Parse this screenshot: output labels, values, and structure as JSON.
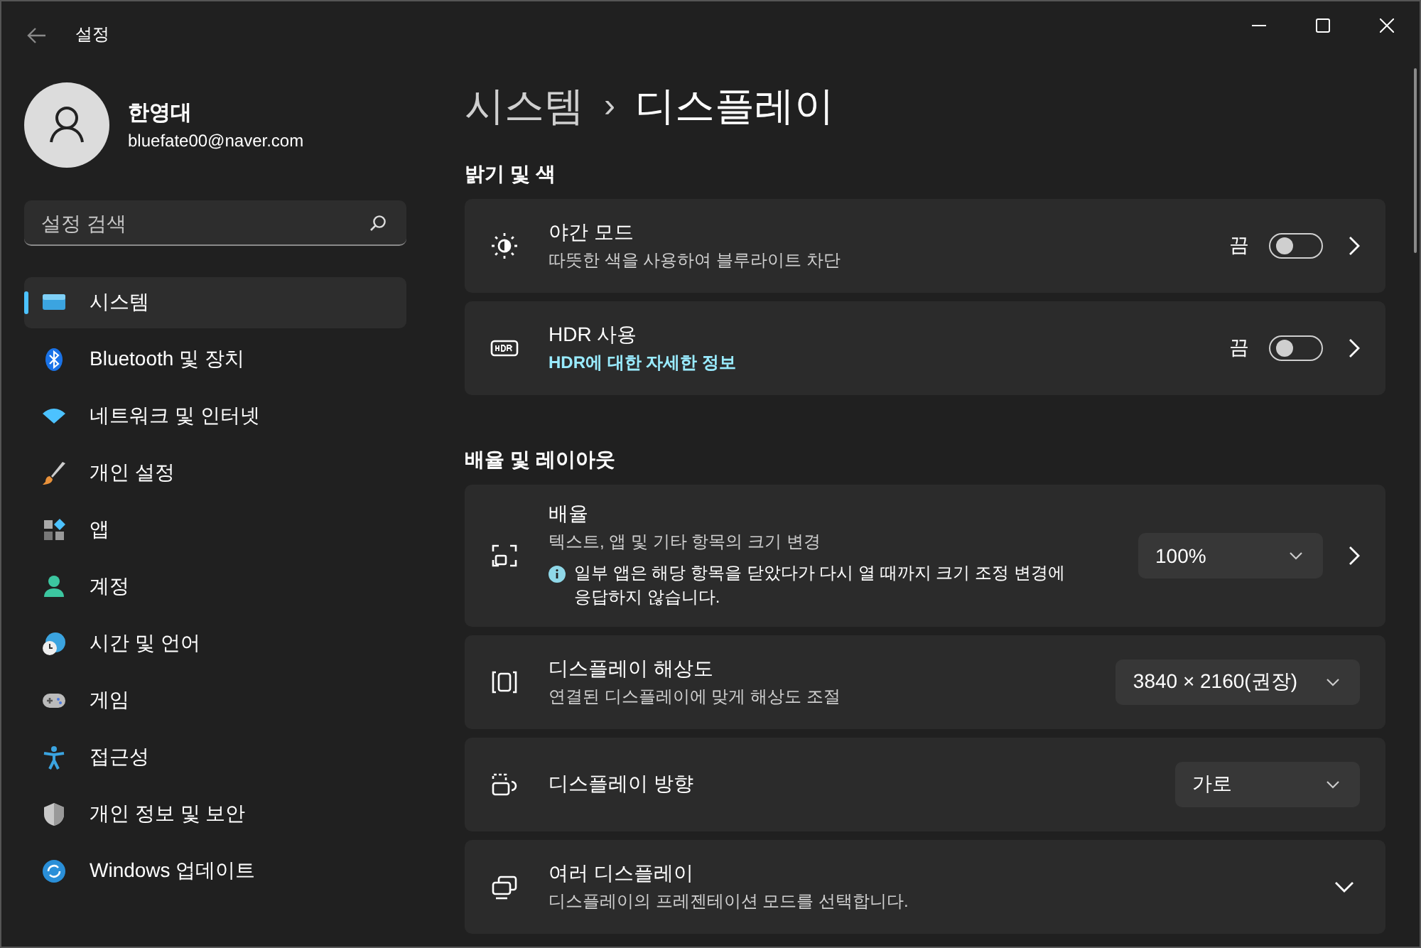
{
  "window": {
    "title": "설정"
  },
  "user": {
    "name": "한영대",
    "email": "bluefate00@naver.com"
  },
  "search": {
    "placeholder": "설정 검색"
  },
  "sidebar": {
    "items": [
      {
        "label": "시스템",
        "selected": true
      },
      {
        "label": "Bluetooth 및 장치",
        "selected": false
      },
      {
        "label": "네트워크 및 인터넷",
        "selected": false
      },
      {
        "label": "개인 설정",
        "selected": false
      },
      {
        "label": "앱",
        "selected": false
      },
      {
        "label": "계정",
        "selected": false
      },
      {
        "label": "시간 및 언어",
        "selected": false
      },
      {
        "label": "게임",
        "selected": false
      },
      {
        "label": "접근성",
        "selected": false
      },
      {
        "label": "개인 정보 및 보안",
        "selected": false
      },
      {
        "label": "Windows 업데이트",
        "selected": false
      }
    ]
  },
  "breadcrumb": {
    "parent": "시스템",
    "separator": "›",
    "current": "디스플레이"
  },
  "sections": [
    {
      "heading": "밝기 및 색",
      "cards": [
        {
          "kind": "toggle",
          "title": "야간 모드",
          "subtitle": "따뜻한 색을 사용하여 블루라이트 차단",
          "state_label": "끔",
          "on": false,
          "chevron": true
        },
        {
          "kind": "toggle",
          "title": "HDR 사용",
          "link": "HDR에 대한 자세한 정보",
          "state_label": "끔",
          "on": false,
          "chevron": true
        }
      ]
    },
    {
      "heading": "배율 및 레이아웃",
      "cards": [
        {
          "kind": "dropdown",
          "title": "배율",
          "subtitle": "텍스트, 앱 및 기타 항목의 크기 변경",
          "note": "일부 앱은 해당 항목을 닫았다가 다시 열 때까지 크기 조정 변경에 응답하지 않습니다.",
          "value": "100%",
          "chevron": true
        },
        {
          "kind": "dropdown",
          "title": "디스플레이 해상도",
          "subtitle": "연결된 디스플레이에 맞게 해상도 조절",
          "value": "3840 × 2160(권장)",
          "chevron": false
        },
        {
          "kind": "dropdown",
          "title": "디스플레이 방향",
          "value": "가로",
          "chevron": false
        },
        {
          "kind": "expander",
          "title": "여러 디스플레이",
          "subtitle": "디스플레이의 프레젠테이션 모드를 선택합니다.",
          "expanded": false
        }
      ]
    }
  ]
}
